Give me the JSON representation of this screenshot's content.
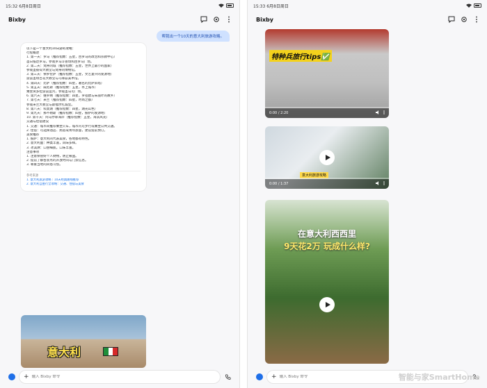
{
  "left": {
    "status": {
      "time": "15:32",
      "date": "6月8日周日"
    },
    "app_title": "Bixby",
    "user_message": "帮我出一个10天的意大利旅游攻略。",
    "answer_lines": [
      "以下是一个意大利10日游的攻略：",
      "行程概述",
      "1. 第一天：罗马（推荐指数：五星，古罗马的政治和宗教中心）",
      "   首日抵达罗马，参观罗马斗兽场和古罗马广场。",
      "2. 第二天：梵蒂冈城（推荐指数：五星，世界上最小的国家）",
      "   参观圣彼得大教堂与梵蒂冈博物馆。",
      "3. 第三天：佛罗伦萨（推荐指数：五星，文艺复兴的发源地）",
      "   游览圣母百花大教堂与乌菲兹美术馆。",
      "4. 第四天：比萨（推荐指数：四星，著名的比萨斜塔）",
      "5. 第五天：威尼斯（推荐指数：五星，水上城市）",
      "   乘坐贡多拉游览运河，参观圣马可广场。",
      "6. 第六天：维罗纳（推荐指数：四星，罗密欧与朱丽叶的故乡）",
      "7. 第七天：米兰（推荐指数：四星，时尚之都）",
      "   参观米兰大教堂与斯福尔扎城堡。",
      "8. 第八天：科莫湖（推荐指数：四星，湖光山色）",
      "9. 第九天：那不勒斯（推荐指数：四星，披萨的发源地）",
      "10. 第十天：阿马尔菲海岸（推荐指数：五星，海滨风光）",
      "交通与住宿建议",
      "1. 交通：城市间推荐乘坐火车，城市内可步行或乘坐公共交通。",
      "2. 住宿：可选择酒店、民宿或青年旅舍，建议提前预订。",
      "美食推荐",
      "1. 披萨：意大利的代表美食，各地都有特色。",
      "2. 意大利面：种类丰富，风味多样。",
      "3. 冰淇淋：口感细腻，口味丰富。",
      "注意事项",
      "1. 注意保管好个人财物，防止被盗。",
      "2. 提前了解各景点的开放时间与门票信息。",
      "3. 尊重当地的风俗习惯。"
    ],
    "sources_label": "参考来源",
    "source_links": [
      "1. 意大利旅游攻略｜10天经典路线推荐",
      "2. 意大利自由行全攻略：交通、住宿与美食"
    ],
    "thumb_text": "意大利",
    "flag_colors": [
      "#1f8f3a",
      "#ffffff",
      "#d62b2b"
    ],
    "input_placeholder": "输入 Bixby 命令"
  },
  "right": {
    "status": {
      "time": "15:33",
      "date": "6月8日周日"
    },
    "app_title": "Bixby",
    "videos": [
      {
        "caption": "特种兵旅行tips✅",
        "time": "0:00 / 2:20",
        "progress": 0
      },
      {
        "caption": "意大利旅游攻略",
        "time": "0:00 / 1:37",
        "progress": 0
      },
      {
        "title_1": "在意大利西西里",
        "title_2": "9天花2万 玩成什么样?",
        "time": "",
        "progress": 0
      }
    ],
    "input_placeholder": "输入 Bixby 命令"
  },
  "watermark": "智能与家SmartHome",
  "colors": {
    "accent": "#1f6fe8",
    "bubble": "#cfe1ff",
    "link": "#1a73e8"
  }
}
